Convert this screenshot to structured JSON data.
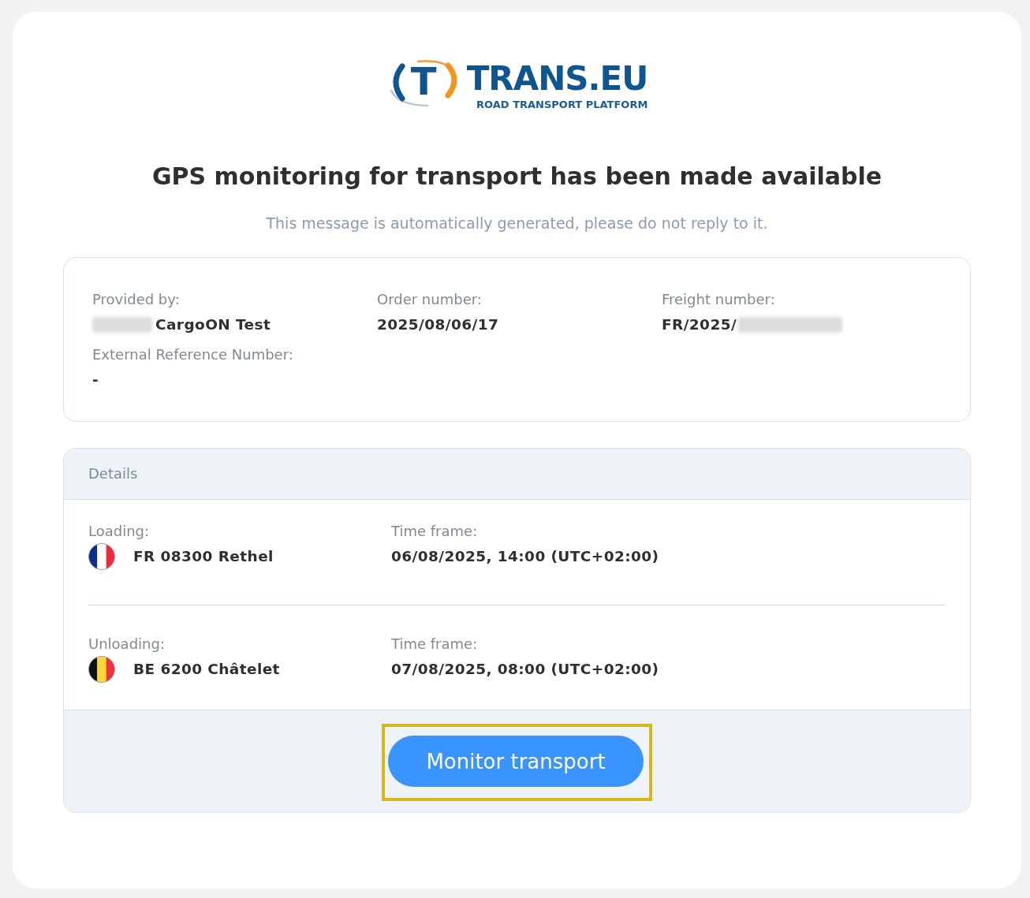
{
  "logo": {
    "letter": "T",
    "wordmark": "TRANS.EU",
    "tagline": "ROAD TRANSPORT PLATFORM"
  },
  "title": "GPS monitoring for transport has been made available",
  "notice": "This message is automatically generated, please do not reply to it.",
  "summary": {
    "fields": [
      {
        "label": "Provided by:",
        "value": "CargoON Test",
        "blurred_before": true
      },
      {
        "label": "Order number:",
        "value": "2025/08/06/17"
      },
      {
        "label": "Freight number:",
        "value": "FR/2025/",
        "blurred_after": true
      },
      {
        "label": "External Reference Number:",
        "value": "-"
      }
    ]
  },
  "details": {
    "title": "Details",
    "stops": [
      {
        "kind": "france",
        "label": "Loading:",
        "place": "FR 08300 Rethel",
        "time_label": "Time frame:",
        "time": "06/08/2025, 14:00 (UTC+02:00)"
      },
      {
        "kind": "belgium",
        "label": "Unloading:",
        "place": "BE 6200 Châtelet",
        "time_label": "Time frame:",
        "time": "07/08/2025, 08:00 (UTC+02:00)"
      }
    ],
    "button": {
      "label": "Monitor transport",
      "highlighted": true
    }
  }
}
